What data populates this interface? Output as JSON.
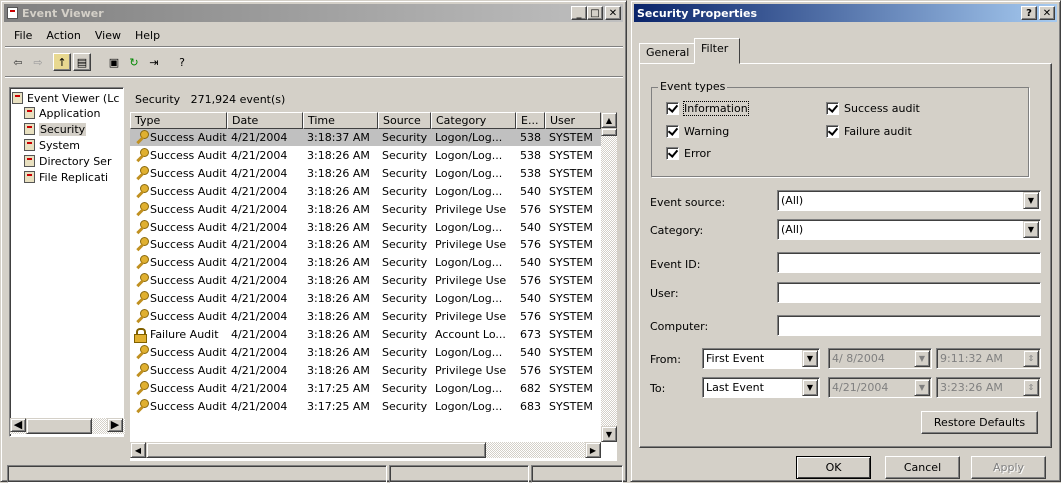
{
  "event_viewer": {
    "title": "Event Viewer",
    "menu": [
      "File",
      "Action",
      "View",
      "Help"
    ],
    "tree": {
      "root": "Event Viewer (Lc",
      "items": [
        "Application",
        "Security",
        "System",
        "Directory Ser",
        "File Replicati"
      ]
    },
    "list_title": "Security",
    "event_count": "271,924 event(s)",
    "columns": [
      "Type",
      "Date",
      "Time",
      "Source",
      "Category",
      "E...",
      "User"
    ],
    "rows": [
      [
        "Success Audit",
        "4/21/2004",
        "3:18:37 AM",
        "Security",
        "Logon/Log...",
        "538",
        "SYSTEM"
      ],
      [
        "Success Audit",
        "4/21/2004",
        "3:18:26 AM",
        "Security",
        "Logon/Log...",
        "538",
        "SYSTEM"
      ],
      [
        "Success Audit",
        "4/21/2004",
        "3:18:26 AM",
        "Security",
        "Logon/Log...",
        "538",
        "SYSTEM"
      ],
      [
        "Success Audit",
        "4/21/2004",
        "3:18:26 AM",
        "Security",
        "Logon/Log...",
        "540",
        "SYSTEM"
      ],
      [
        "Success Audit",
        "4/21/2004",
        "3:18:26 AM",
        "Security",
        "Privilege Use",
        "576",
        "SYSTEM"
      ],
      [
        "Success Audit",
        "4/21/2004",
        "3:18:26 AM",
        "Security",
        "Logon/Log...",
        "540",
        "SYSTEM"
      ],
      [
        "Success Audit",
        "4/21/2004",
        "3:18:26 AM",
        "Security",
        "Privilege Use",
        "576",
        "SYSTEM"
      ],
      [
        "Success Audit",
        "4/21/2004",
        "3:18:26 AM",
        "Security",
        "Logon/Log...",
        "540",
        "SYSTEM"
      ],
      [
        "Success Audit",
        "4/21/2004",
        "3:18:26 AM",
        "Security",
        "Privilege Use",
        "576",
        "SYSTEM"
      ],
      [
        "Success Audit",
        "4/21/2004",
        "3:18:26 AM",
        "Security",
        "Logon/Log...",
        "540",
        "SYSTEM"
      ],
      [
        "Success Audit",
        "4/21/2004",
        "3:18:26 AM",
        "Security",
        "Privilege Use",
        "576",
        "SYSTEM"
      ],
      [
        "Failure Audit",
        "4/21/2004",
        "3:18:26 AM",
        "Security",
        "Account Lo...",
        "673",
        "SYSTEM"
      ],
      [
        "Success Audit",
        "4/21/2004",
        "3:18:26 AM",
        "Security",
        "Logon/Log...",
        "540",
        "SYSTEM"
      ],
      [
        "Success Audit",
        "4/21/2004",
        "3:18:26 AM",
        "Security",
        "Privilege Use",
        "576",
        "SYSTEM"
      ],
      [
        "Success Audit",
        "4/21/2004",
        "3:17:25 AM",
        "Security",
        "Logon/Log...",
        "682",
        "SYSTEM"
      ],
      [
        "Success Audit",
        "4/21/2004",
        "3:17:25 AM",
        "Security",
        "Logon/Log...",
        "683",
        "SYSTEM"
      ]
    ]
  },
  "props": {
    "title": "Security Properties",
    "tabs": [
      "General",
      "Filter"
    ],
    "group_title": "Event types",
    "checks": [
      {
        "label": "Information",
        "checked": true
      },
      {
        "label": "Warning",
        "checked": true
      },
      {
        "label": "Error",
        "checked": true
      },
      {
        "label": "Success audit",
        "checked": true
      },
      {
        "label": "Failure audit",
        "checked": true
      }
    ],
    "event_source_label": "Event source:",
    "event_source_value": "(All)",
    "category_label": "Category:",
    "category_value": "(All)",
    "event_id_label": "Event ID:",
    "user_label": "User:",
    "computer_label": "Computer:",
    "from_label": "From:",
    "from_value": "First Event",
    "from_date": "4/ 8/2004",
    "from_time": "9:11:32 AM",
    "to_label": "To:",
    "to_value": "Last Event",
    "to_date": "4/21/2004",
    "to_time": "3:23:26 AM",
    "restore_defaults": "Restore Defaults",
    "ok": "OK",
    "cancel": "Cancel",
    "apply": "Apply"
  }
}
